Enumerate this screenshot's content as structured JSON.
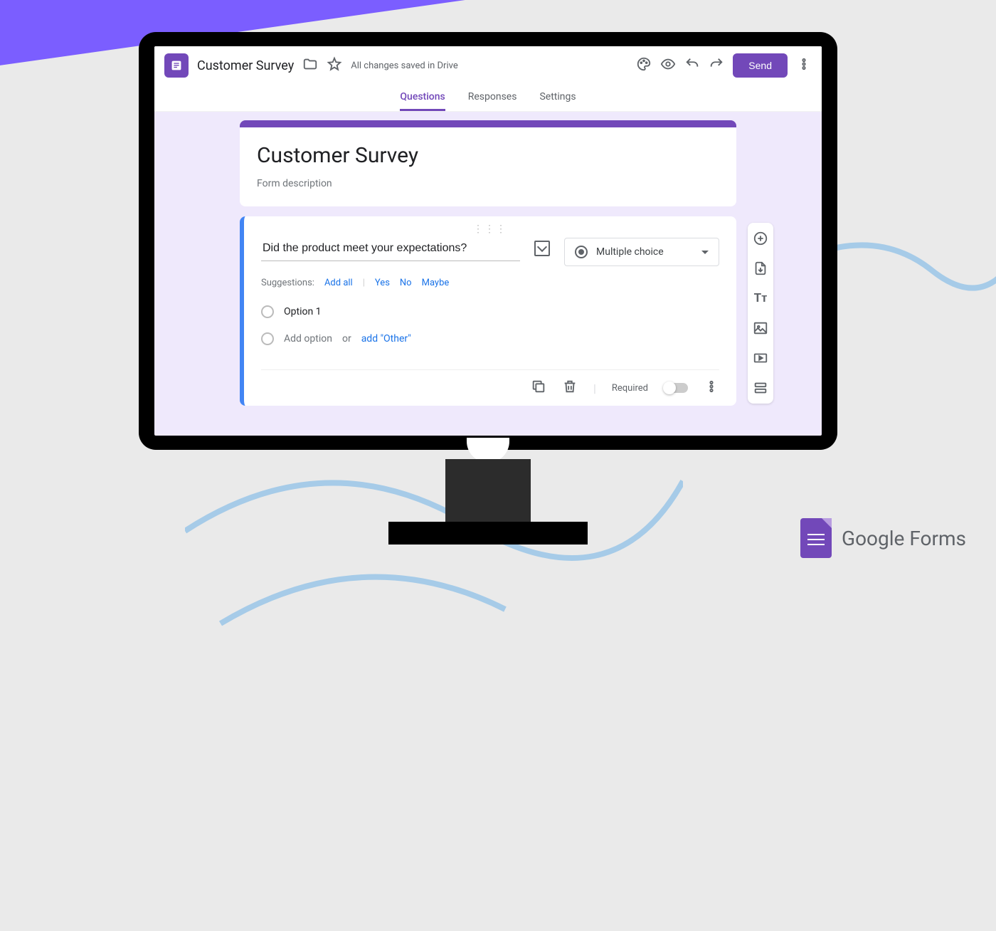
{
  "header": {
    "title": "Customer Survey",
    "save_status": "All changes saved in Drive",
    "send": "Send"
  },
  "tabs": [
    "Questions",
    "Responses",
    "Settings"
  ],
  "form": {
    "title": "Customer Survey",
    "desc": "Form description"
  },
  "question": {
    "text": "Did the product meet your expectations?",
    "type": "Multiple choice"
  },
  "suggestions": {
    "label": "Suggestions:",
    "add_all": "Add all",
    "items": [
      "Yes",
      "No",
      "Maybe"
    ]
  },
  "options": {
    "opt1": "Option 1",
    "add": "Add option",
    "or": "or",
    "other": "add \"Other\""
  },
  "footer": {
    "required": "Required"
  },
  "brand": "Google Forms"
}
